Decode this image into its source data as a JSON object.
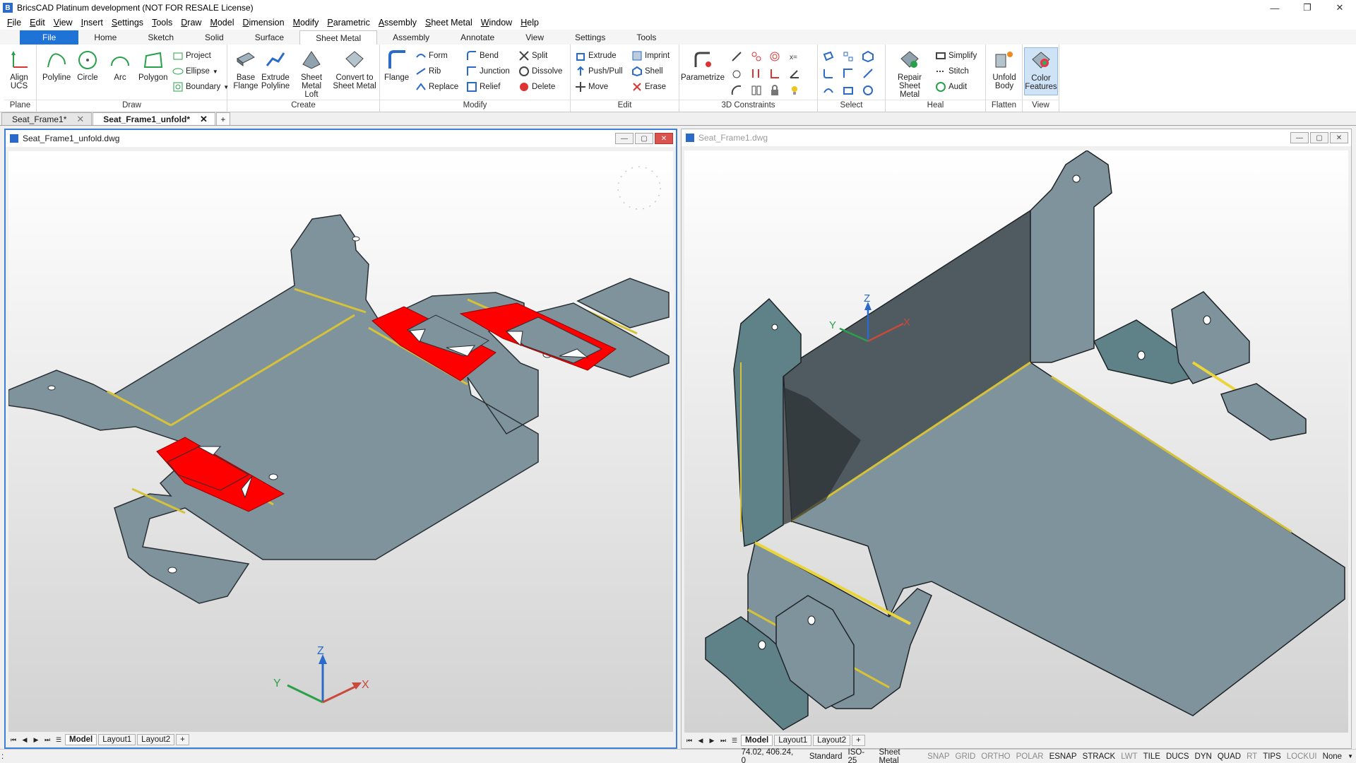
{
  "app": {
    "title": "BricsCAD Platinum development (NOT FOR RESALE License)",
    "icon": "bricscad-icon",
    "window_buttons": [
      "—",
      "❐",
      "✕"
    ]
  },
  "menubar": [
    "File",
    "Edit",
    "View",
    "Insert",
    "Settings",
    "Tools",
    "Draw",
    "Model",
    "Dimension",
    "Modify",
    "Parametric",
    "Assembly",
    "Sheet Metal",
    "Window",
    "Help"
  ],
  "ribbon_tabs": [
    "File",
    "Home",
    "Sketch",
    "Solid",
    "Surface",
    "Sheet Metal",
    "Assembly",
    "Annotate",
    "View",
    "Settings",
    "Tools"
  ],
  "ribbon_active_tab": "Sheet Metal",
  "ribbon": {
    "plane": {
      "label": "Plane",
      "align_ucs": "Align UCS"
    },
    "draw": {
      "label": "Draw",
      "polyline": "Polyline",
      "circle": "Circle",
      "arc": "Arc",
      "polygon": "Polygon",
      "project": "Project",
      "ellipse": "Ellipse",
      "boundary": "Boundary"
    },
    "create": {
      "label": "Create",
      "base_flange": "Base Flange",
      "extrude_polyline": "Extrude Polyline",
      "sheet_metal_loft": "Sheet Metal Loft",
      "convert": "Convert to Sheet Metal"
    },
    "modify": {
      "label": "Modify",
      "flange": "Flange",
      "form": "Form",
      "rib": "Rib",
      "replace": "Replace",
      "bend": "Bend",
      "junction": "Junction",
      "relief": "Relief",
      "split": "Split",
      "dissolve": "Dissolve",
      "delete": "Delete"
    },
    "edit": {
      "label": "Edit",
      "extrude": "Extrude",
      "push_pull": "Push/Pull",
      "move": "Move",
      "imprint": "Imprint",
      "shell": "Shell",
      "erase": "Erase"
    },
    "constraints": {
      "label": "3D Constraints",
      "parametrize": "Parametrize"
    },
    "select": {
      "label": "Select"
    },
    "heal": {
      "label": "Heal",
      "repair": "Repair Sheet Metal",
      "simplify": "Simplify",
      "stitch": "Stitch",
      "audit": "Audit"
    },
    "flatten": {
      "label": "Flatten",
      "unfold_body": "Unfold Body"
    },
    "view": {
      "label": "View",
      "color_features": "Color Features"
    }
  },
  "doc_tabs": [
    {
      "label": "Seat_Frame1*",
      "active": false
    },
    {
      "label": "Seat_Frame1_unfold*",
      "active": true
    }
  ],
  "windows": {
    "left": {
      "title": "Seat_Frame1_unfold.dwg",
      "layouts": [
        "Model",
        "Layout1",
        "Layout2"
      ]
    },
    "right": {
      "title": "Seat_Frame1.dwg",
      "layouts": [
        "Model",
        "Layout1",
        "Layout2"
      ]
    }
  },
  "axes": {
    "x": "X",
    "y": "Y",
    "z": "Z"
  },
  "colors": {
    "sheet": "#7f939c",
    "sheet_edge": "#2a2f33",
    "bend": "#d6c23a",
    "feature_red": "#ff0000",
    "accent": "#1f73d6"
  },
  "statusbar": {
    "prompt": ":",
    "coords": "74.02, 406.24, 0",
    "items": [
      {
        "label": "Standard",
        "on": true
      },
      {
        "label": "ISO-25",
        "on": true
      },
      {
        "label": "Sheet Metal",
        "on": true
      },
      {
        "label": "SNAP",
        "on": false
      },
      {
        "label": "GRID",
        "on": false
      },
      {
        "label": "ORTHO",
        "on": false
      },
      {
        "label": "POLAR",
        "on": false
      },
      {
        "label": "ESNAP",
        "on": true
      },
      {
        "label": "STRACK",
        "on": true
      },
      {
        "label": "LWT",
        "on": false
      },
      {
        "label": "TILE",
        "on": true
      },
      {
        "label": "DUCS",
        "on": true
      },
      {
        "label": "DYN",
        "on": true
      },
      {
        "label": "QUAD",
        "on": true
      },
      {
        "label": "RT",
        "on": false
      },
      {
        "label": "TIPS",
        "on": true
      },
      {
        "label": "LOCKUI",
        "on": false
      },
      {
        "label": "None",
        "on": true
      }
    ]
  }
}
